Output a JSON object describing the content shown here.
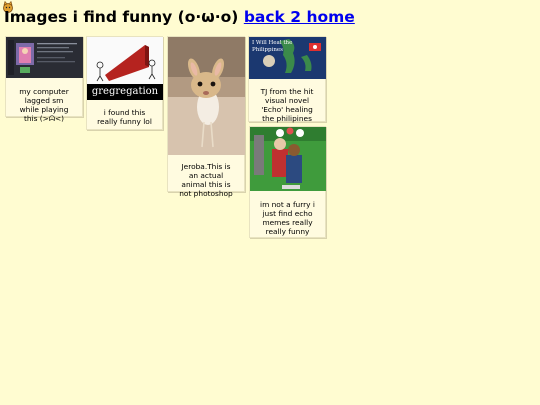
{
  "header": {
    "title": "Images i find funny (o·ω·o)",
    "home_link": "back 2 home"
  },
  "gallery": [
    {
      "caption": "my computer lagged sm while playing this (>ᗣ<)"
    },
    {
      "caption": "i found this really funny lol",
      "thumb_text": "gregregation"
    },
    {
      "caption": "Jeroba.This is an actual animal this is not photoshop"
    },
    {
      "caption": "TJ from the hit visual novel 'Echo' healing the philipines",
      "thumb_text": "I Will Heal the Philippines"
    },
    {
      "caption": "im not a furry i just find echo memes really really funny"
    }
  ],
  "colors": {
    "background": "#fffcd1",
    "link": "#0000ee"
  }
}
